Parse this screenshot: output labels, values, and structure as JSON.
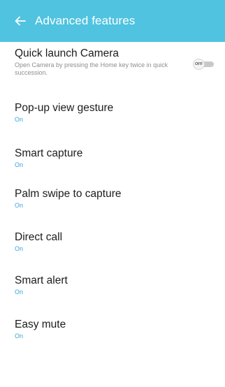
{
  "header": {
    "title": "Advanced features",
    "back_icon": "back-arrow-icon",
    "color": "#4fc3df"
  },
  "settings": [
    {
      "title": "Quick launch Camera",
      "description": "Open Camera by pressing the Home key twice in quick succession.",
      "toggle_label": "OFF",
      "toggle_state": false
    },
    {
      "title": "Pop-up view gesture",
      "status": "On"
    },
    {
      "title": "Smart capture",
      "status": "On"
    },
    {
      "title": "Palm swipe to capture",
      "status": "On"
    },
    {
      "title": "Direct call",
      "status": "On"
    },
    {
      "title": "Smart alert",
      "status": "On"
    },
    {
      "title": "Easy mute",
      "status": "On"
    }
  ],
  "colors": {
    "accent": "#3aa6d8",
    "text_primary": "#1c1c1c",
    "text_secondary": "#8e8e8e"
  }
}
